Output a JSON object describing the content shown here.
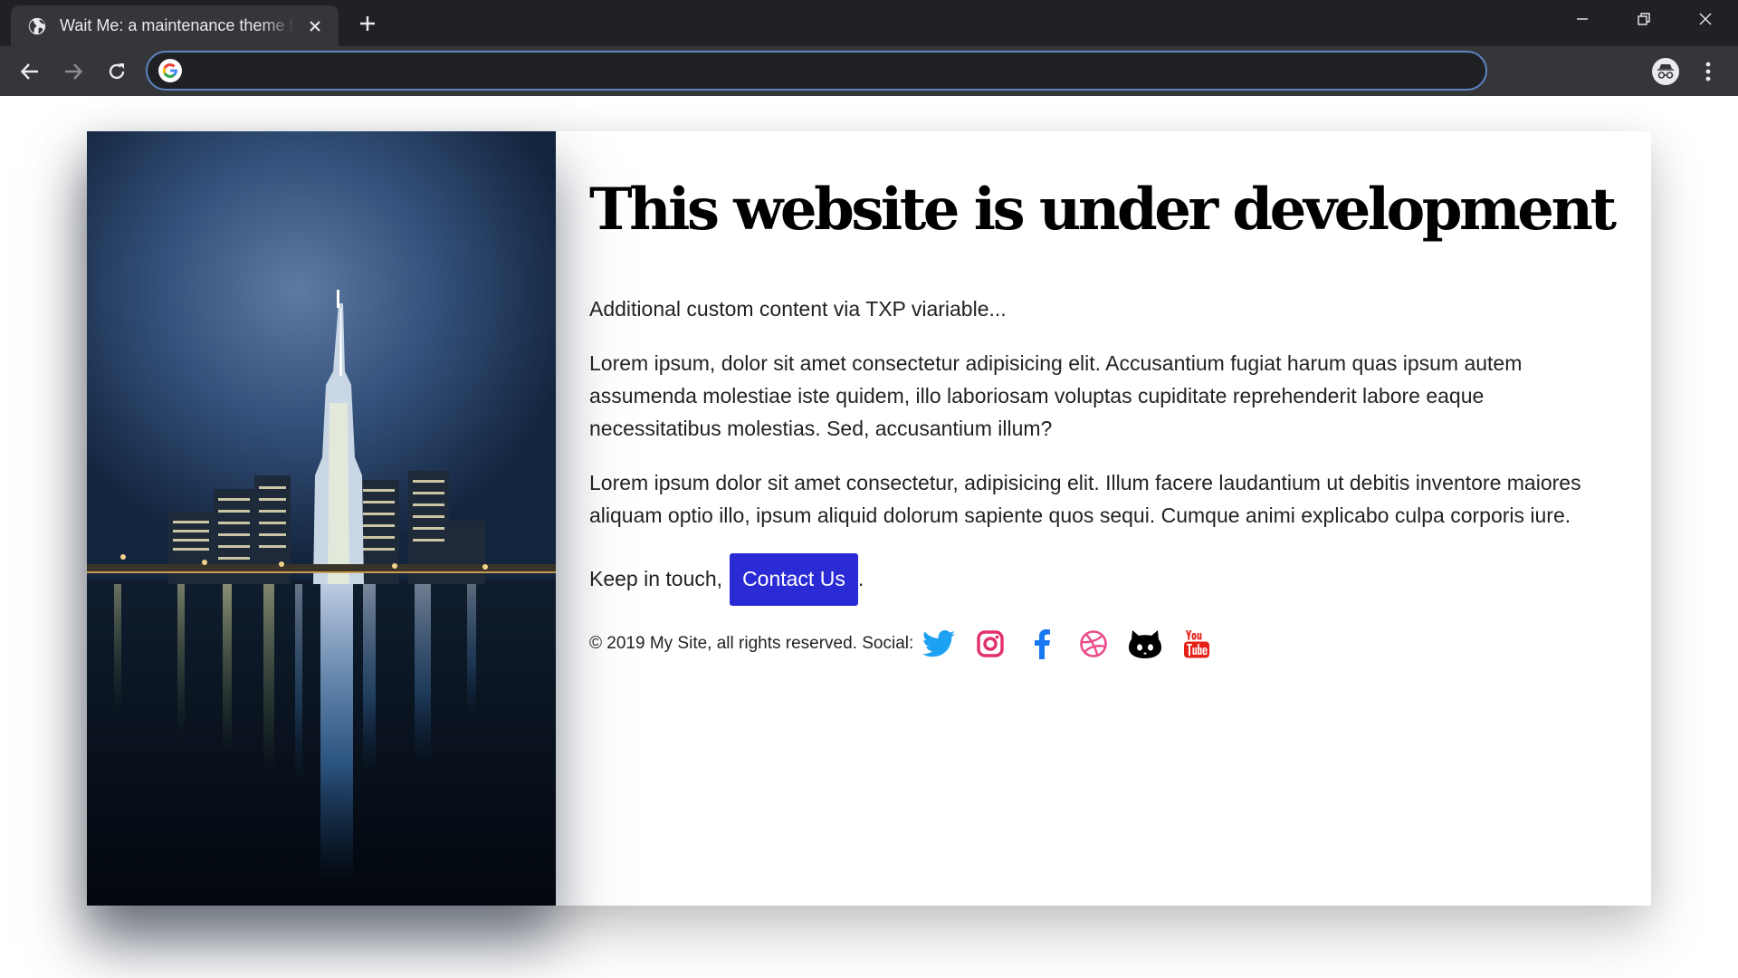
{
  "browser": {
    "tab": {
      "title": "Wait Me: a maintenance theme for Textpattern CMS"
    },
    "new_tab_icon": "plus-icon",
    "window_controls": [
      "minimize-icon",
      "restore-icon",
      "close-icon"
    ],
    "toolbar": {
      "back_icon": "arrow-left-icon",
      "forward_icon": "arrow-right-icon",
      "reload_icon": "reload-icon",
      "omnibox": {
        "value": "",
        "icon": "google-icon"
      },
      "profile_icon": "incognito-icon",
      "menu_icon": "kebab-menu-icon"
    }
  },
  "page": {
    "hero_image": "city-skyline-night-river-reflection",
    "headline": "This website is under development",
    "intro": "Additional custom content via TXP viariable...",
    "paragraphs": [
      "Lorem ipsum, dolor sit amet consectetur adipisicing elit. Accusantium fugiat harum quas ipsum autem assumenda molestiae iste quidem, illo laboriosam voluptas cupiditate reprehenderit labore eaque necessitatibus molestias. Sed, accusantium illum?",
      "Lorem ipsum dolor sit amet consectetur, adipisicing elit. Illum facere laudantium ut debitis inventore maiores aliquam optio illo, ipsum aliquid dolorum sapiente quos sequi. Cumque animi explicabo culpa corporis iure."
    ],
    "keep_in_touch": "Keep in touch,",
    "contact_button": "Contact Us",
    "after_button": ".",
    "footer": {
      "copyright": "© 2019 My Site, all rights reserved. Social:",
      "social": [
        {
          "name": "twitter",
          "color": "#1da1f2"
        },
        {
          "name": "instagram",
          "color": "#e1306c"
        },
        {
          "name": "facebook",
          "color": "#1877f2"
        },
        {
          "name": "dribbble",
          "color": "#ea4c89"
        },
        {
          "name": "github",
          "color": "#000000"
        },
        {
          "name": "youtube",
          "color": "#e62117"
        }
      ]
    },
    "colors": {
      "button_bg": "#2b2bd6",
      "chrome_dark": "#202124",
      "chrome_toolbar": "#35363a",
      "omnibox_border": "#5f84c2"
    }
  }
}
